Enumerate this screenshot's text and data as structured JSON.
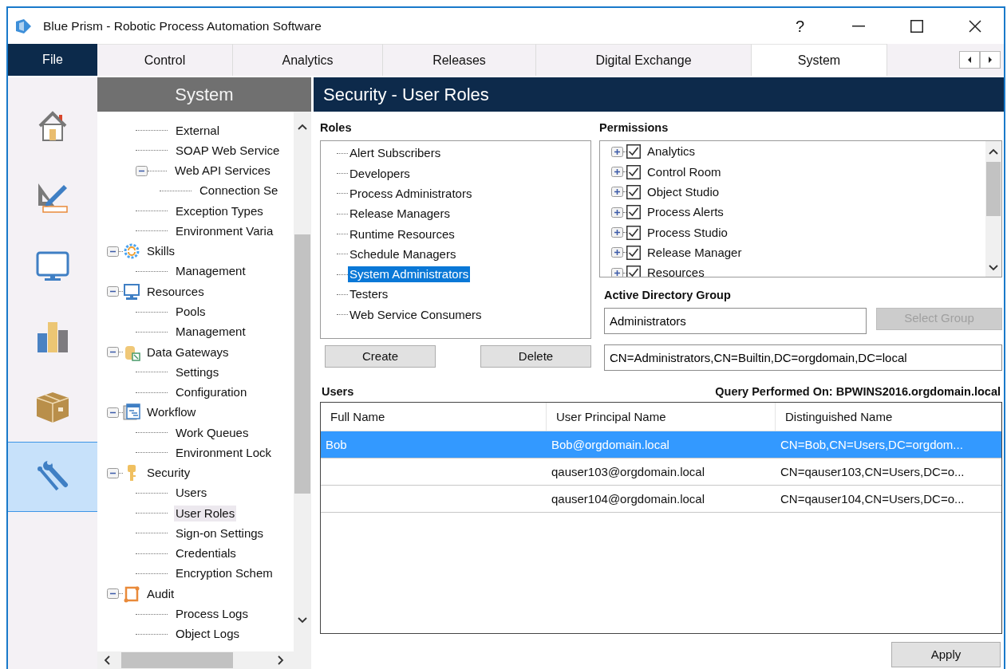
{
  "window": {
    "title": "Blue Prism - Robotic Process Automation Software",
    "help": "?"
  },
  "tabs": [
    {
      "label": "File",
      "kind": "file",
      "selected": false
    },
    {
      "label": "Control",
      "kind": "tab",
      "selected": false
    },
    {
      "label": "Analytics",
      "kind": "tab",
      "selected": false
    },
    {
      "label": "Releases",
      "kind": "tab",
      "selected": false
    },
    {
      "label": "Digital Exchange",
      "kind": "tab",
      "selected": false
    },
    {
      "label": "System",
      "kind": "tab",
      "selected": true
    }
  ],
  "rail": [
    {
      "selected": false
    },
    {
      "selected": false
    },
    {
      "selected": false
    },
    {
      "selected": false
    },
    {
      "selected": false
    },
    {
      "selected": true
    }
  ],
  "nav": {
    "title": "System",
    "continued_items": [
      {
        "label": "External",
        "selected": false
      },
      {
        "label": "SOAP Web Service",
        "selected": false
      },
      {
        "label": "Web API Services",
        "selected": false,
        "expanded": true,
        "children": [
          {
            "label": "Connection Se",
            "selected": false
          }
        ]
      },
      {
        "label": "Exception Types",
        "selected": false
      },
      {
        "label": "Environment Varia",
        "selected": false
      }
    ],
    "items": [
      {
        "label": "Skills",
        "expanded": true,
        "selected": false,
        "children": [
          {
            "label": "Management",
            "selected": false
          }
        ]
      },
      {
        "label": "Resources",
        "expanded": true,
        "selected": false,
        "children": [
          {
            "label": "Pools",
            "selected": false
          },
          {
            "label": "Management",
            "selected": false
          }
        ]
      },
      {
        "label": "Data Gateways",
        "expanded": true,
        "selected": false,
        "children": [
          {
            "label": "Settings",
            "selected": false
          },
          {
            "label": "Configuration",
            "selected": false
          }
        ]
      },
      {
        "label": "Workflow",
        "expanded": true,
        "selected": false,
        "children": [
          {
            "label": "Work Queues",
            "selected": false
          },
          {
            "label": "Environment Lock",
            "selected": false
          }
        ]
      },
      {
        "label": "Security",
        "expanded": true,
        "selected": false,
        "children": [
          {
            "label": "Users",
            "selected": false
          },
          {
            "label": "User Roles",
            "selected": true
          },
          {
            "label": "Sign-on Settings",
            "selected": false
          },
          {
            "label": "Credentials",
            "selected": false
          },
          {
            "label": "Encryption Schem",
            "selected": false
          }
        ]
      },
      {
        "label": "Audit",
        "expanded": true,
        "selected": false,
        "children": [
          {
            "label": "Process Logs",
            "selected": false
          },
          {
            "label": "Object Logs",
            "selected": false
          }
        ]
      }
    ]
  },
  "page": {
    "title": "Security - User Roles",
    "roles": {
      "label": "Roles",
      "items": [
        {
          "label": "Alert Subscribers",
          "selected": false
        },
        {
          "label": "Developers",
          "selected": false
        },
        {
          "label": "Process Administrators",
          "selected": false
        },
        {
          "label": "Release Managers",
          "selected": false
        },
        {
          "label": "Runtime Resources",
          "selected": false
        },
        {
          "label": "Schedule Managers",
          "selected": false
        },
        {
          "label": "System Administrators",
          "selected": true
        },
        {
          "label": "Testers",
          "selected": false
        },
        {
          "label": "Web Service Consumers",
          "selected": false
        }
      ],
      "buttons": [
        {
          "label": "Create",
          "disabled": false
        },
        {
          "label": "Delete",
          "disabled": false
        }
      ]
    },
    "permissions": {
      "label": "Permissions",
      "items": [
        {
          "label": "Analytics",
          "checked": true,
          "expanded": false
        },
        {
          "label": "Control Room",
          "checked": true,
          "expanded": false
        },
        {
          "label": "Object Studio",
          "checked": true,
          "expanded": false
        },
        {
          "label": "Process Alerts",
          "checked": true,
          "expanded": false
        },
        {
          "label": "Process Studio",
          "checked": true,
          "expanded": false
        },
        {
          "label": "Release Manager",
          "checked": true,
          "expanded": false
        },
        {
          "label": "Resources",
          "checked": true,
          "expanded": false
        }
      ]
    },
    "ad_group": {
      "label": "Active Directory Group",
      "value": "Administrators",
      "button": {
        "label": "Select Group",
        "disabled": true
      },
      "distinguished_name": "CN=Administrators,CN=Builtin,DC=orgdomain,DC=local"
    },
    "users": {
      "label": "Users",
      "query": "Query Performed On: BPWINS2016.orgdomain.local",
      "columns": [
        "Full Name",
        "User Principal Name",
        "Distinguished Name"
      ],
      "rows": [
        {
          "cells": [
            "Bob",
            "Bob@orgdomain.local",
            "CN=Bob,CN=Users,DC=orgdom..."
          ],
          "selected": true
        },
        {
          "cells": [
            "",
            "qauser103@orgdomain.local",
            "CN=qauser103,CN=Users,DC=o..."
          ],
          "selected": false
        },
        {
          "cells": [
            "",
            "qauser104@orgdomain.local",
            "CN=qauser104,CN=Users,DC=o..."
          ],
          "selected": false
        }
      ]
    },
    "apply": {
      "label": "Apply",
      "disabled": false
    }
  }
}
